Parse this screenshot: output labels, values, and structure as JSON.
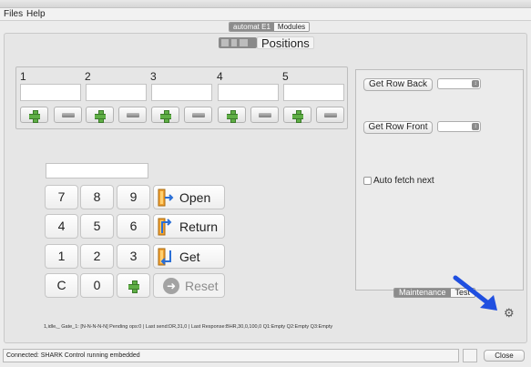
{
  "menu": {
    "files": "Files",
    "help": "Help"
  },
  "top_tabs": [
    "automat E1",
    "Modules"
  ],
  "page_title": "Positions",
  "positions": [
    {
      "label": "1",
      "value": ""
    },
    {
      "label": "2",
      "value": ""
    },
    {
      "label": "3",
      "value": ""
    },
    {
      "label": "4",
      "value": ""
    },
    {
      "label": "5",
      "value": ""
    }
  ],
  "right_panel": {
    "get_row_back": "Get Row Back",
    "get_row_front": "Get Row Front",
    "row_back_value": "",
    "row_front_value": "",
    "auto_fetch_label": "Auto fetch next",
    "auto_fetch_checked": false
  },
  "sub_tabs": [
    "Maintenance",
    "Test"
  ],
  "keypad": {
    "entry_value": "",
    "keys": [
      "7",
      "8",
      "9",
      "4",
      "5",
      "6",
      "1",
      "2",
      "3",
      "C",
      "0"
    ],
    "actions": {
      "open": "Open",
      "return": "Return",
      "get": "Get",
      "reset": "Reset"
    }
  },
  "status_line": "1,idle,_ Gate_1: [N-N-N-N-N] Pending ops:0 | Last send:DR,31,0 | Last Response:BHR,30,0,100,0  Q1:Empty Q2:Empty Q3:Empty",
  "statusbar": {
    "message": "Connected: SHARK Control running embedded"
  },
  "close_button": "Close",
  "colors": {
    "plus_green": "#5fae45",
    "arrow_blue": "#1f4fe0",
    "tab_active": "#8c8c8c"
  }
}
